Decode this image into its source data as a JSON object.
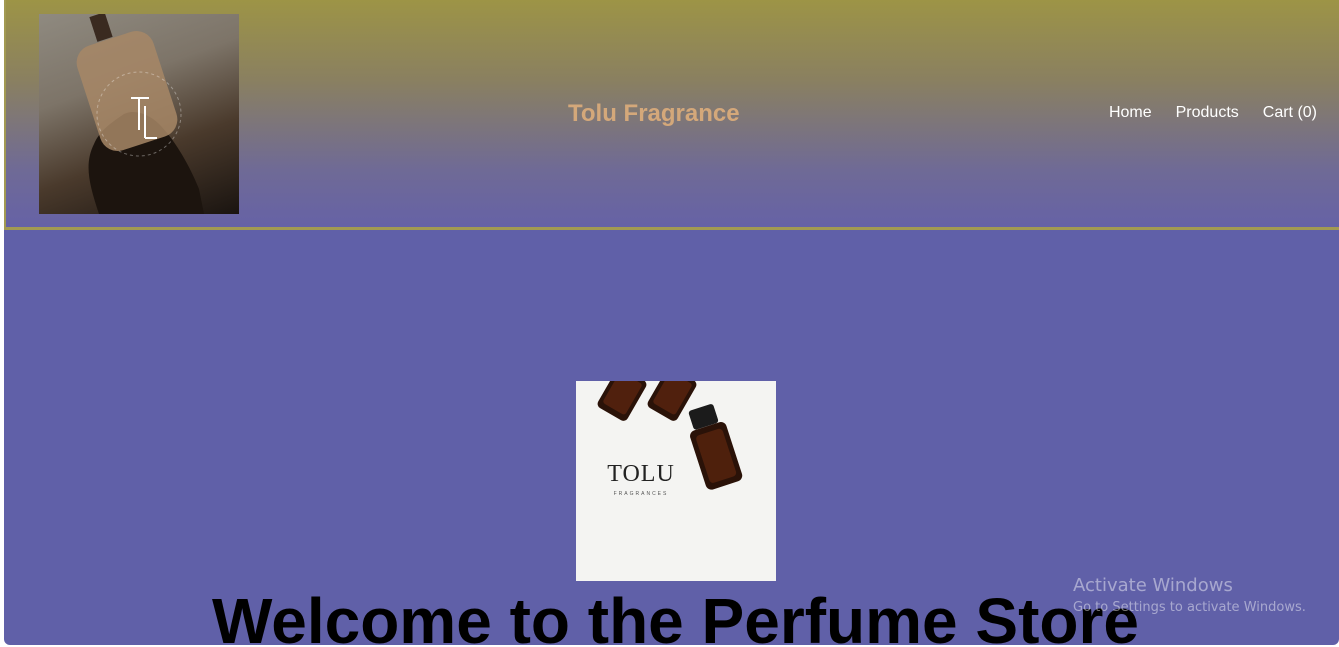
{
  "header": {
    "brand": "Tolu Fragrance",
    "nav": {
      "home": "Home",
      "products": "Products",
      "cart": "Cart (0)"
    }
  },
  "hero": {
    "image_title": "TOLU",
    "image_subtitle": "FRAGRANCES",
    "welcome": "Welcome to the Perfume Store"
  },
  "watermark": {
    "title": "Activate Windows",
    "subtitle": "Go to Settings to activate Windows."
  },
  "colors": {
    "brand": "#d4a87a",
    "background": "#6060a8",
    "header_top": "#9d9446",
    "border": "#a29a52"
  }
}
